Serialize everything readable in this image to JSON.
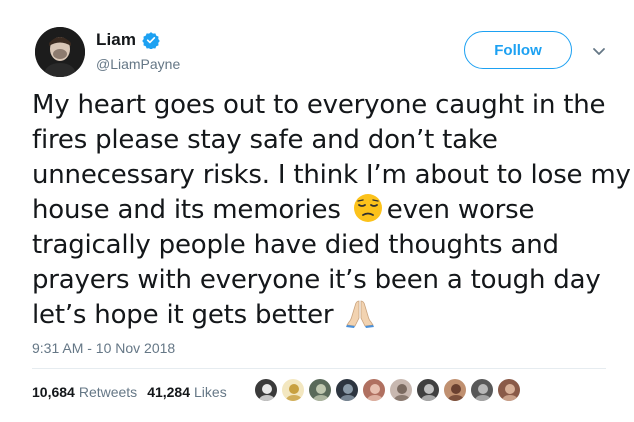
{
  "header": {
    "display_name": "Liam",
    "handle": "@LiamPayne",
    "follow_label": "Follow",
    "verified_icon": "verified-badge-icon",
    "menu_icon": "chevron-down-icon"
  },
  "tweet": {
    "lines": [
      "My heart goes out to everyone caught in the",
      "fires please stay safe and don’t take",
      "unnecessary risks. I think I’m about to lose my",
      "house and its memories",
      "even worse",
      "tragically people have died thoughts and",
      "prayers with everyone it’s been a tough day",
      "let’s hope it gets better"
    ],
    "emojis": [
      "pensive-face-emoji",
      "folded-hands-emoji"
    ],
    "timestamp": "9:31 AM - 10 Nov 2018"
  },
  "stats": {
    "retweets_count": "10,684",
    "retweets_label": "Retweets",
    "likes_count": "41,284",
    "likes_label": "Likes"
  },
  "colors": {
    "accent": "#1da1f2",
    "text": "#14171a",
    "secondary": "#657786",
    "divider": "#e6ecf0"
  },
  "liker_avatars": [
    {
      "bg": "#3a3a3a",
      "fg": "#e8e8e8"
    },
    {
      "bg": "#f3e7c0",
      "fg": "#c8a040"
    },
    {
      "bg": "#5a6a5a",
      "fg": "#c0c8b0"
    },
    {
      "bg": "#2d3540",
      "fg": "#8a9aa8"
    },
    {
      "bg": "#b07060",
      "fg": "#e8c0b0"
    },
    {
      "bg": "#c8b8b0",
      "fg": "#7a6a60"
    },
    {
      "bg": "#404040",
      "fg": "#c0c0c0"
    },
    {
      "bg": "#c09070",
      "fg": "#6a4030"
    },
    {
      "bg": "#585858",
      "fg": "#b8b8b8"
    },
    {
      "bg": "#8a5a48",
      "fg": "#d8b098"
    }
  ]
}
